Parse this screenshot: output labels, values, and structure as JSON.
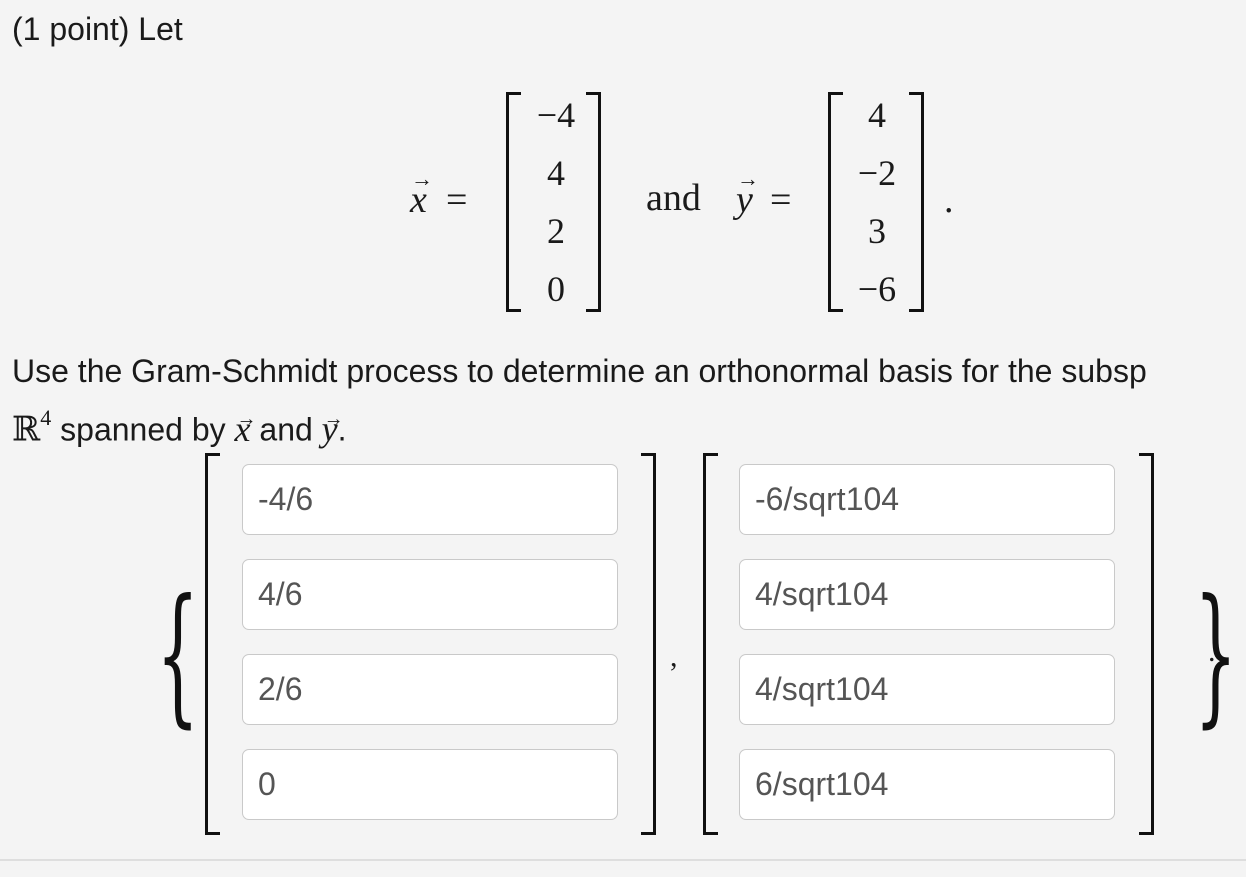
{
  "header": {
    "text": "(1 point) Let"
  },
  "vectors": {
    "x": {
      "symbol": "x",
      "arrow": "→",
      "eq": "=",
      "entries": [
        "−4",
        "4",
        "2",
        "0"
      ]
    },
    "connector": "and",
    "y": {
      "symbol": "y",
      "arrow": "→",
      "eq": "=",
      "entries": [
        "4",
        "−2",
        "3",
        "−6"
      ]
    },
    "end_period": "."
  },
  "prompt": {
    "line1": "Use the Gram-Schmidt process to determine an orthonormal basis for the subsp",
    "rr_symbol": "ℝ",
    "rr_exp": "4",
    "line2_a": " spanned by ",
    "x_sym": "x",
    "line2_b": " and ",
    "y_sym": "y",
    "line2_c": "."
  },
  "answer": {
    "open_brace": "{",
    "close_brace": "}",
    "separator": ",",
    "end_period": ".",
    "vector1": [
      "-4/6",
      "4/6",
      "2/6",
      "0"
    ],
    "vector2": [
      "-6/sqrt104",
      "4/sqrt104",
      "4/sqrt104",
      "6/sqrt104"
    ]
  }
}
